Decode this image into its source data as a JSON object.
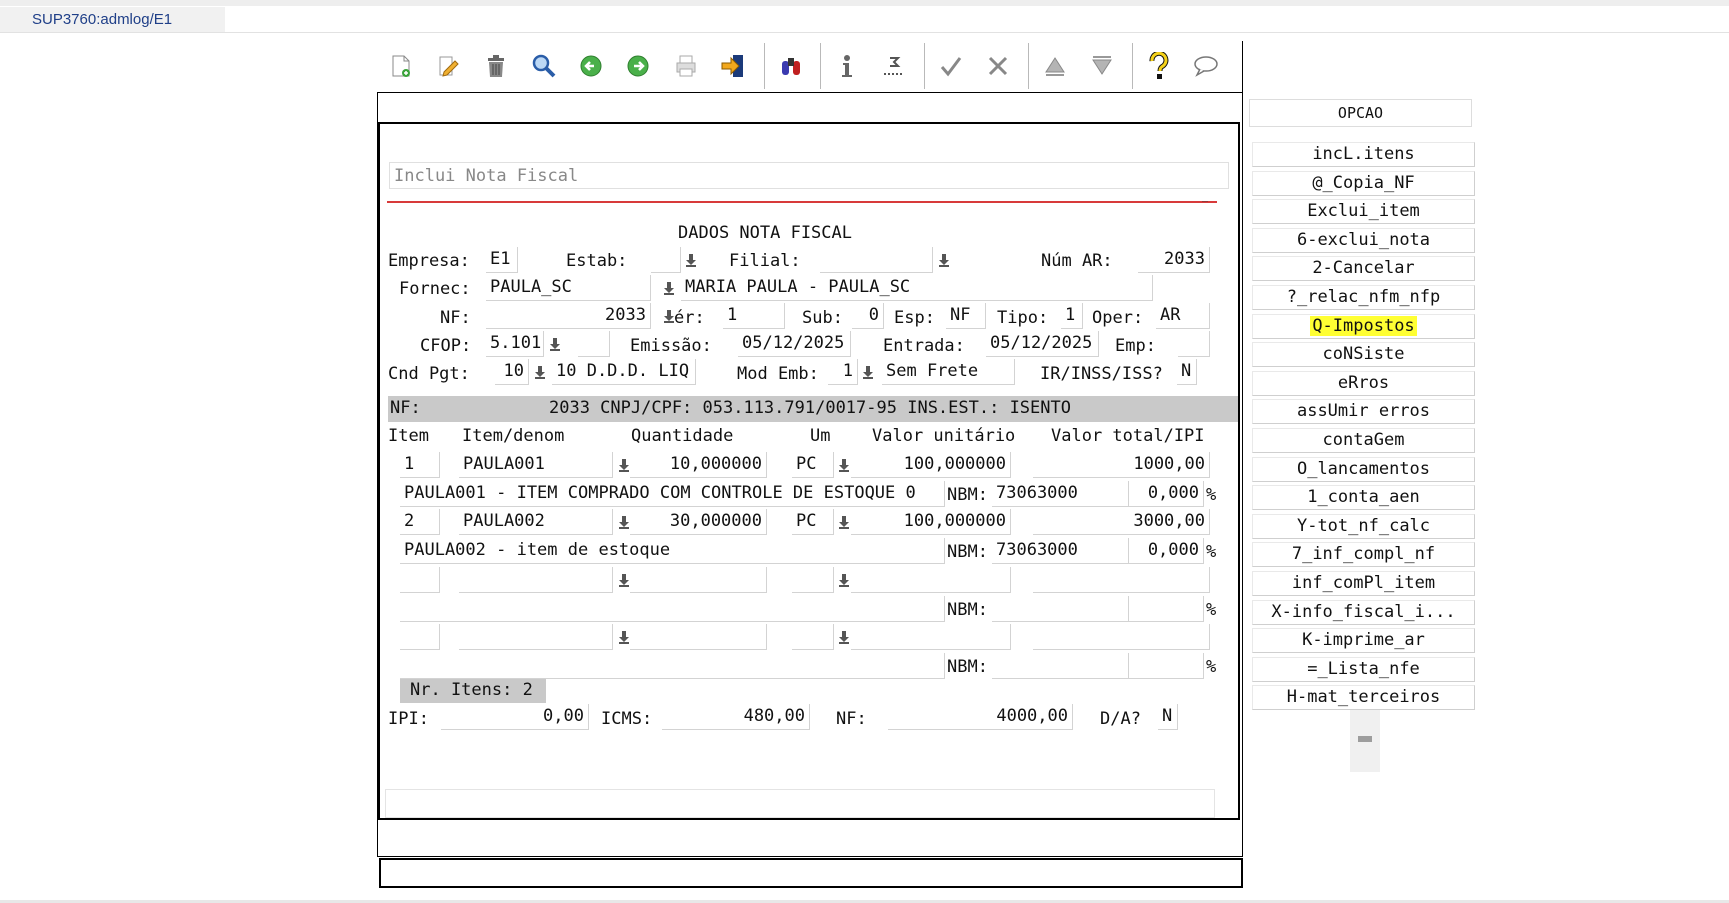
{
  "tab": {
    "title": "SUP3760:admlog/E1"
  },
  "toolbar": {
    "icons": [
      "new-document-icon",
      "edit-icon",
      "delete-trash-icon",
      "search-icon",
      "previous-icon",
      "next-icon",
      "print-icon",
      "export-icon",
      "binoculars-icon",
      "info-icon",
      "sum-icon",
      "confirm-check-icon",
      "cancel-x-icon",
      "up-triangle-icon",
      "down-triangle-icon",
      "help-icon",
      "comment-icon"
    ]
  },
  "form": {
    "title_placeholder": "Inclui Nota Fiscal",
    "section_title": "DADOS NOTA FISCAL",
    "labels": {
      "empresa": "Empresa:",
      "estab": "Estab:",
      "filial": "Filial:",
      "num_ar": "Núm AR:",
      "fornec": "Fornec:",
      "nf": "NF:",
      "ser": "ér:",
      "sub": "Sub:",
      "esp": "Esp:",
      "tipo": "Tipo:",
      "oper": "Oper:",
      "cfop": "CFOP:",
      "emissao": "Emissão:",
      "entrada": "Entrada:",
      "emp": "Emp:",
      "cnd_pgt": "Cnd Pgt:",
      "mod_emb": "Mod Emb:",
      "ir_inss_iss": "IR/INSS/ISS?"
    },
    "values": {
      "empresa": "E1",
      "estab": "",
      "filial": "",
      "num_ar": "2033",
      "fornec_code": "PAULA_SC",
      "fornec_name": "MARIA PAULA - PAULA_SC",
      "nf": "2033",
      "ser": "1",
      "sub": "0",
      "esp": "NF",
      "tipo": "1",
      "oper": "AR",
      "cfop": "5.101",
      "cfop_extra": "",
      "emissao": "05/12/2025",
      "entrada": "05/12/2025",
      "emp": "",
      "cnd_pgt": "10",
      "cnd_pgt_desc": "10 D.D.D. LIQ",
      "mod_emb": "1",
      "mod_emb_desc": "Sem Frete",
      "ir_inss_iss": "N"
    },
    "info_band": {
      "label": "NF:",
      "text": "2033 CNPJ/CPF: 053.113.791/0017-95 INS.EST.: ISENTO"
    },
    "columns": {
      "item": "Item",
      "denom": "Item/denom",
      "quantidade": "Quantidade",
      "um": "Um",
      "valor_unit": "Valor unitário",
      "valor_total": "Valor total/IPI"
    },
    "nbm_label": "NBM:",
    "pct": "%",
    "items": [
      {
        "item": "1",
        "code": "PAULA001",
        "qty": "10,000000",
        "um": "PC",
        "unit": "100,000000",
        "total": "1000,00",
        "desc": "PAULA001 - ITEM COMPRADO COM CONTROLE DE ESTOQUE 0",
        "nbm": "73063000",
        "ipi": "0,000"
      },
      {
        "item": "2",
        "code": "PAULA002",
        "qty": "30,000000",
        "um": "PC",
        "unit": "100,000000",
        "total": "3000,00",
        "desc": "PAULA002 - item de estoque",
        "nbm": "73063000",
        "ipi": "0,000"
      },
      {
        "item": "",
        "code": "",
        "qty": "",
        "um": "",
        "unit": "",
        "total": "",
        "desc": "",
        "nbm": "",
        "ipi": ""
      },
      {
        "item": "",
        "code": "",
        "qty": "",
        "um": "",
        "unit": "",
        "total": "",
        "desc": "",
        "nbm": "",
        "ipi": ""
      }
    ],
    "nr_itens": "Nr. Itens: 2",
    "totals": {
      "ipi_label": "IPI:",
      "ipi": "0,00",
      "icms_label": "ICMS:",
      "icms": "480,00",
      "nf_label": "NF:",
      "nf": "4000,00",
      "da_label": "D/A?",
      "da": "N"
    }
  },
  "opcao": {
    "header": "OPCAO",
    "highlight_color": "#ffff33",
    "items": [
      "incL.itens",
      "@_Copia_NF",
      "Exclui_item",
      "6-exclui_nota",
      "2-Cancelar",
      "?_relac_nfm_nfp",
      "Q-Impostos",
      "coNSiste",
      "eRros",
      "assUmir erros",
      "contaGem",
      "O_lancamentos",
      "1_conta_aen",
      "Y-tot_nf_calc",
      "7_inf_compl_nf",
      "inf_comPl_item",
      "X-info_fiscal_i...",
      "K-imprime_ar",
      "=_Lista_nfe",
      "H-mat_terceiros"
    ]
  }
}
